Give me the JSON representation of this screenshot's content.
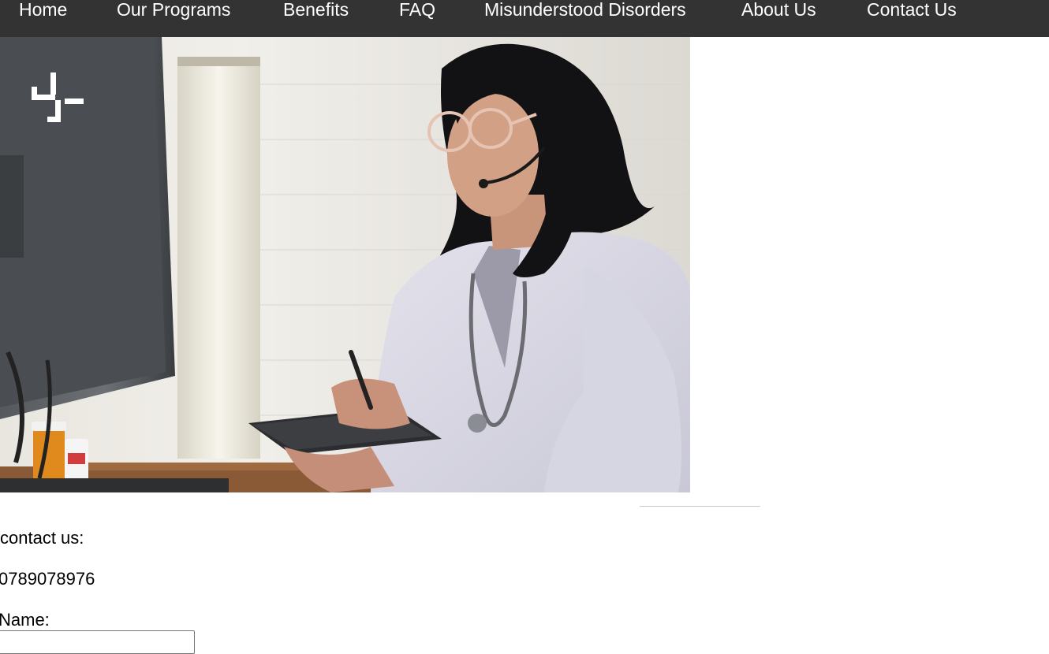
{
  "nav": {
    "items": [
      {
        "label": "Home"
      },
      {
        "label": "Our Programs"
      },
      {
        "label": "Benefits"
      },
      {
        "label": "FAQ"
      },
      {
        "label": "Misunderstood Disorders"
      },
      {
        "label": "About Us"
      },
      {
        "label": "Contact Us"
      }
    ],
    "background": "#333333",
    "text_color": "#ffffff"
  },
  "hero": {
    "image": "doctor-with-headset-at-computer-photo",
    "logo_icon": "plus-cross-logo-icon"
  },
  "contact": {
    "heading": "contact us:",
    "phone": "0789078976",
    "name_label": "Name:",
    "name_value": ""
  }
}
